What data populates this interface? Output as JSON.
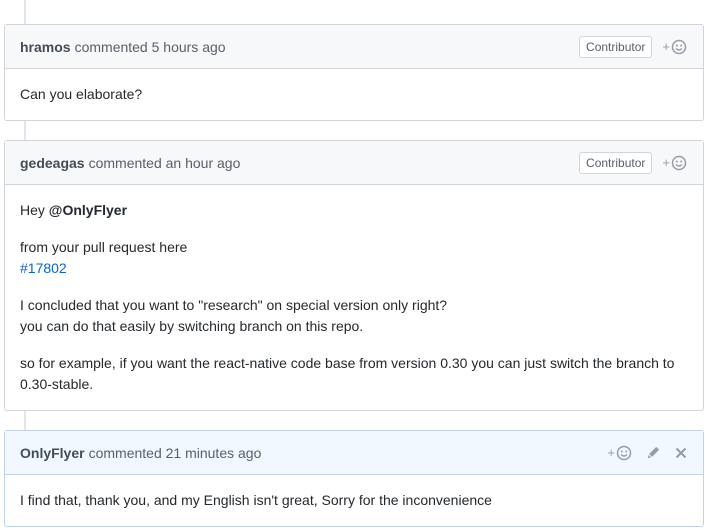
{
  "comments": [
    {
      "author": "hramos",
      "meta": "commented 5 hours ago",
      "badge": "Contributor",
      "body": [
        "Can you elaborate?"
      ]
    },
    {
      "author": "gedeagas",
      "meta": "commented an hour ago",
      "badge": "Contributor",
      "greeting": "Hey",
      "mention": "@OnlyFlyer",
      "line1": "from your pull request here",
      "link": "#17802",
      "para2_line1": "I concluded that you want to \"research\" on special version only right?",
      "para2_line2": "you can do that easily by switching branch on this repo.",
      "para3": "so for example, if you want the react-native code base from version 0.30 you can just switch the branch to 0.30-stable."
    },
    {
      "author": "OnlyFlyer",
      "meta": "commented 21 minutes ago",
      "body": [
        "I find that, thank you, and my English isn't great, Sorry for the inconvenience"
      ]
    }
  ],
  "ui": {
    "react_symbol": "+",
    "icons": [
      "smiley-icon",
      "pencil-icon",
      "close-icon"
    ]
  }
}
